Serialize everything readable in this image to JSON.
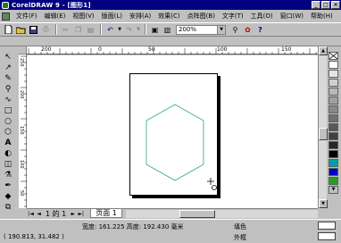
{
  "window": {
    "title": "CorelDRAW 9 - [图形1]",
    "controls": [
      "_",
      "□",
      "×"
    ]
  },
  "menu": {
    "items": [
      "文件(F)",
      "编辑(E)",
      "视图(V)",
      "版面(L)",
      "安排(A)",
      "效果(C)",
      "点阵图(B)",
      "文字(T)",
      "工具(O)",
      "窗口(W)",
      "帮助(H)"
    ]
  },
  "toolbar": {
    "zoom_value": "200%"
  },
  "rulers": {
    "h_ticks": [
      "200",
      "0",
      "50",
      "100",
      "150"
    ],
    "v_ticks": [
      "250",
      "200",
      "150",
      "100",
      "50"
    ]
  },
  "page_nav": {
    "first": "|◄",
    "prev": "◄",
    "page_status": "1 的 1",
    "next": "►",
    "last": "►|",
    "tab_label": "页面 1"
  },
  "status": {
    "size": "宽度: 161.225 高度: 192.430 毫米",
    "coords": "( 190.813, 31.482 )",
    "fill_label": "填色",
    "outline_label": "外框"
  },
  "colors": {
    "hexagon_stroke": "#2aa88a",
    "palette": [
      "#ffffff",
      "#e6e6e6",
      "#d0d0d0",
      "#b8b8b8",
      "#a0a0a0",
      "#888888",
      "#707070",
      "#585858",
      "#404040",
      "#282828",
      "#000000",
      "#00a0a0",
      "#0000c0",
      "#20a020"
    ]
  }
}
